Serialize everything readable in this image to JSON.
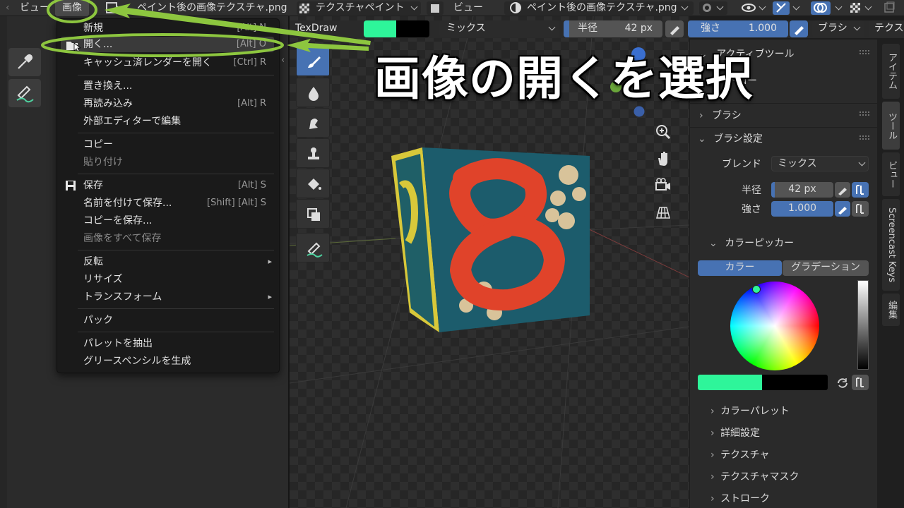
{
  "topbar": {
    "view_left": "ビュー",
    "image_menu": "画像",
    "image_name_left": "ペイント後の画像テクスチャ.png",
    "mode": "テクスチャペイント",
    "view_right": "ビュー",
    "image_name_right": "ペイント後の画像テクスチャ.png"
  },
  "tool_header": {
    "brush_name": "TexDraw",
    "blend": "ミックス",
    "radius_label": "半径",
    "radius_value": "42 px",
    "strength_label": "強さ",
    "strength_value": "1.000",
    "brush_menu": "ブラシ",
    "texture_menu": "テクス"
  },
  "menu": {
    "items": [
      {
        "label": "新規",
        "shortcut": "[Alt] N"
      },
      {
        "label": "開く...",
        "shortcut": "[Alt] O"
      },
      {
        "label": "キャッシュ済レンダーを開く",
        "shortcut": "[Ctrl] R"
      },
      {
        "label": "置き換え..."
      },
      {
        "label": "再読み込み",
        "shortcut": "[Alt] R"
      },
      {
        "label": "外部エディターで編集"
      },
      {
        "label": "コピー"
      },
      {
        "label": "貼り付け"
      },
      {
        "label": "保存",
        "shortcut": "[Alt] S"
      },
      {
        "label": "名前を付けて保存...",
        "shortcut": "[Shift] [Alt] S"
      },
      {
        "label": "コピーを保存..."
      },
      {
        "label": "画像をすべて保存"
      },
      {
        "label": "反転"
      },
      {
        "label": "リサイズ"
      },
      {
        "label": "トランスフォーム"
      },
      {
        "label": "パック"
      },
      {
        "label": "パレットを抽出"
      },
      {
        "label": "グリースペンシルを生成"
      }
    ]
  },
  "annotation": {
    "caption": "画像の開くを選択",
    "accent": "#8dc63f"
  },
  "sidebar": {
    "active_tool": "アクティブツール",
    "active_tool_sub": "ドロー",
    "brush": "ブラシ",
    "brush_settings": "ブラシ設定",
    "blend_label": "ブレンド",
    "blend_value": "ミックス",
    "radius_label": "半径",
    "radius_value": "42 px",
    "strength_label": "強さ",
    "strength_value": "1.000",
    "color_picker": "カラーピッカー",
    "tab_color": "カラー",
    "tab_gradient": "グラデーション",
    "color_palette": "カラーパレット",
    "advanced": "詳細設定",
    "texture": "テクスチャ",
    "texture_mask": "テクスチャマスク",
    "stroke": "ストローク",
    "primary_color": "#2ef59a",
    "secondary_color": "#000000"
  },
  "vtabs": [
    "アイテム",
    "ツール",
    "ビュー",
    "Screencast Keys",
    "編集"
  ]
}
